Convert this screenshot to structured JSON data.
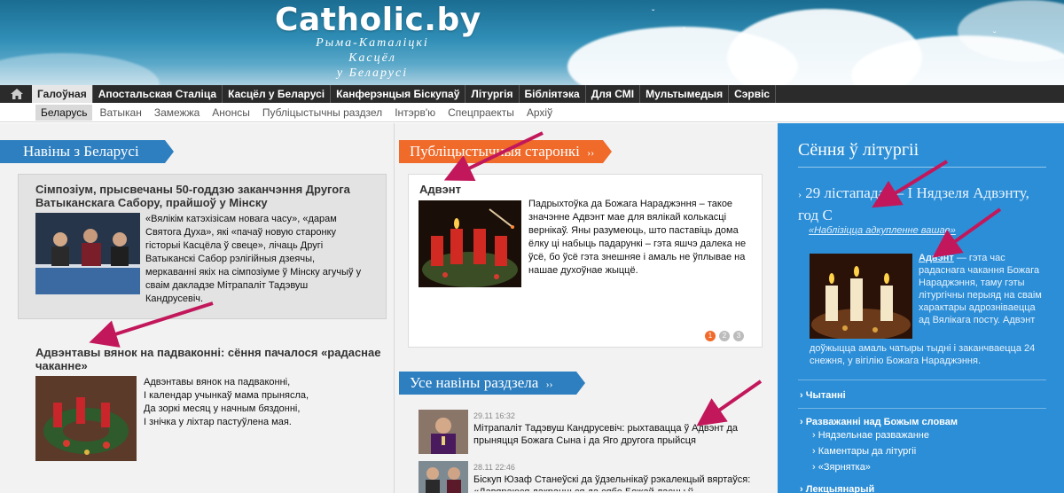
{
  "header": {
    "logo": "Catholic.by",
    "subtitle_line1": "Рыма-Каталіцкі Касцёл",
    "subtitle_line2": "у Беларусі"
  },
  "main_nav": {
    "items": [
      {
        "label": "Галоўная",
        "active": true
      },
      {
        "label": "Апостальская Сталіца"
      },
      {
        "label": "Касцёл у Беларусі"
      },
      {
        "label": "Канферэнцыя Біскупаў"
      },
      {
        "label": "Літургія"
      },
      {
        "label": "Бібліятэка"
      },
      {
        "label": "Для СМІ"
      },
      {
        "label": "Мультымедыя"
      },
      {
        "label": "Сэрвіс"
      }
    ]
  },
  "sub_nav": {
    "items": [
      {
        "label": "Беларусь",
        "active": true
      },
      {
        "label": "Ватыкан"
      },
      {
        "label": "Замежжа"
      },
      {
        "label": "Анонсы"
      },
      {
        "label": "Публіцыстычны раздзел"
      },
      {
        "label": "Інтэрв'ю"
      },
      {
        "label": "Спецпраекты"
      },
      {
        "label": "Архіў"
      }
    ]
  },
  "left": {
    "heading": "Навіны з Беларусі",
    "news1": {
      "title": "Сімпозіум, прысвечаны 50-годдзю заканчэння Другога Ватыканскага Сабору, прайшоў у Мінску",
      "text": "«Вялікім катэхізісам новага часу», «дарам Святога Духа», які «пачаў новую старонку гісторыі Касцёла ў свеце», лічаць Другі Ватыканскі Сабор рэлігійныя дзеячы, меркаванні якіх на сімпозіуме ў Мінску агучыў у сваім дакладзе Мітрапаліт Тадэвуш Кандрусевіч."
    },
    "news2": {
      "title": "Адвэнтавы вянок на падваконні: сёння пачалося «радаснае чаканне»",
      "line1": "Адвэнтавы вянок на падваконні,",
      "line2": "І календар учынкаў мама прынясла,",
      "line3": "Да зоркі месяц у начным бяздонні,",
      "line4": "І знічка у ліхтар пастуўлена мая."
    }
  },
  "middle": {
    "heading": "Публіцыстычныя старонкі",
    "feature": {
      "title": "Адвэнт",
      "text": "Падрыхтоўка да Божага Нараджэння – такое значэнне Адвэнт мае для вялікай колькасці вернікаў. Яны разумеюць, што паставіць дома ёлку ці набыць падарункі – гэта яшчэ далека не ўсё, бо ўсё гэта знешняе і амаль не ўплывае на нашае духоўнае жыццё."
    },
    "pager": [
      "1",
      "2",
      "3"
    ],
    "all_heading": "Усе навіны раздзела",
    "list": [
      {
        "date": "29.11 16:32",
        "text": "Мітрапаліт Тадэвуш Кандрусевіч: рыхтавацца ў Адвэнт да прыняцця Божага Сына і да Яго другога прыйсця"
      },
      {
        "date": "28.11 22:46",
        "text": "Біскуп Юзаф Станеўскі да ўдзельнікаў рэкалекцый вяртаўся: «Давяраюся дакранцься да сябе Божай ласцы ў"
      }
    ]
  },
  "right": {
    "heading": "Сёння ў літургіі",
    "date_line": "29 лістапада — І Нядзеля Адвэнту, год C",
    "quote": "«Наблізіцца адкупленне вашае»",
    "text_side": "— гэта час радаснага чакання Божага Нараджэння, таму гэты літургічны перыяд на сваім характары адрозніваецца ад Вялікага посту. Адвэнт",
    "text_word": "Адвэнт",
    "text_bottom": "доўжыцца амаль чатыры тыдні і заканчваецца 24 снежня, у вігілію Божага Нараджэння.",
    "readings": "Чытанні",
    "reflections": "Разважанні над Божым словам",
    "sub1": "Нядзельнае разважанне",
    "sub2": "Каментары да літургіі",
    "sub3": "«Зярнятка»",
    "lectionary": "Лекцыянарый"
  },
  "colors": {
    "accent_blue": "#2e7fc0",
    "accent_orange": "#f06a2a",
    "right_panel": "#2c8ed6",
    "arrow": "#c2185b"
  }
}
